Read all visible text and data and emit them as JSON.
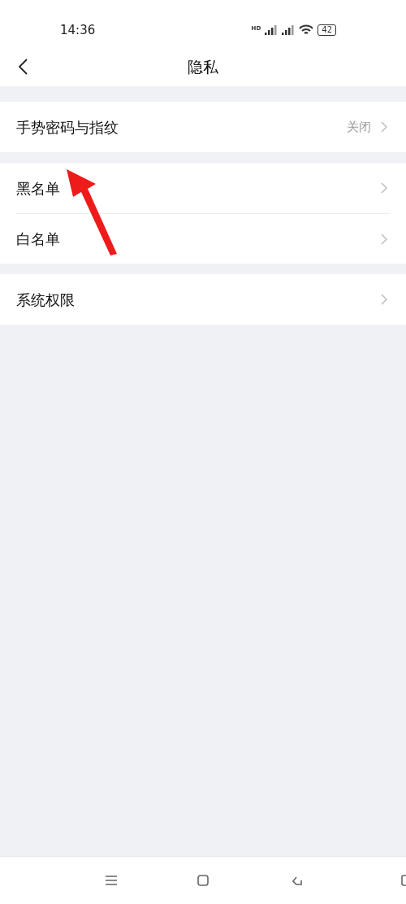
{
  "status_bar": {
    "time": "14:36",
    "network_label": "HD",
    "battery": "42"
  },
  "header": {
    "title": "隐私"
  },
  "groups": [
    {
      "items": [
        {
          "label": "手势密码与指纹",
          "value": "关闭"
        }
      ]
    },
    {
      "items": [
        {
          "label": "黑名单"
        },
        {
          "label": "白名单"
        }
      ]
    },
    {
      "items": [
        {
          "label": "系统权限"
        }
      ]
    }
  ]
}
